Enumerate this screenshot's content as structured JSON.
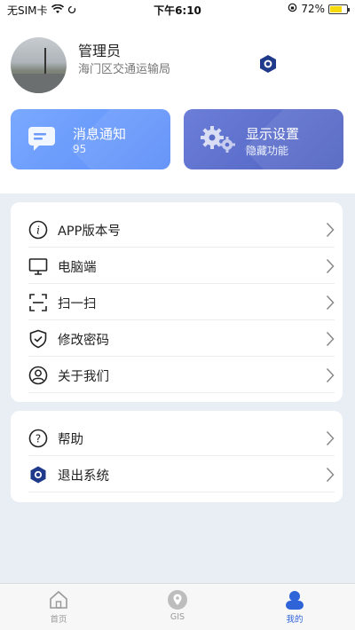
{
  "status_bar": {
    "carrier": "无SIM卡",
    "time": "下午6:10",
    "battery": "72%",
    "battery_level": 0.72
  },
  "profile": {
    "name": "管理员",
    "organization": "海门区交通运输局"
  },
  "cards": {
    "messages": {
      "title": "消息通知",
      "count": "95",
      "icon": "message-icon"
    },
    "display": {
      "title": "显示设置",
      "subtitle": "隐藏功能",
      "icon": "gears-icon"
    }
  },
  "menu_group_1": [
    {
      "label": "APP版本号",
      "icon": "info-icon"
    },
    {
      "label": "电脑端",
      "icon": "monitor-icon"
    },
    {
      "label": "扫一扫",
      "icon": "scan-icon"
    },
    {
      "label": "修改密码",
      "icon": "shield-icon"
    },
    {
      "label": "关于我们",
      "icon": "user-circle-icon"
    }
  ],
  "menu_group_2": [
    {
      "label": "帮助",
      "icon": "help-icon"
    },
    {
      "label": "退出系统",
      "icon": "logout-hexagon-icon"
    }
  ],
  "tabs": [
    {
      "label": "首页",
      "icon": "home-icon",
      "active": false
    },
    {
      "label": "GIS",
      "icon": "location-pin-icon",
      "active": false
    },
    {
      "label": "我的",
      "icon": "person-icon",
      "active": true
    }
  ],
  "colors": {
    "accent": "#2f63d8",
    "brand_dark": "#1f3a8a",
    "card_messages": "#5b8df8",
    "card_display": "#4f61c0",
    "background": "#e9edf4"
  }
}
